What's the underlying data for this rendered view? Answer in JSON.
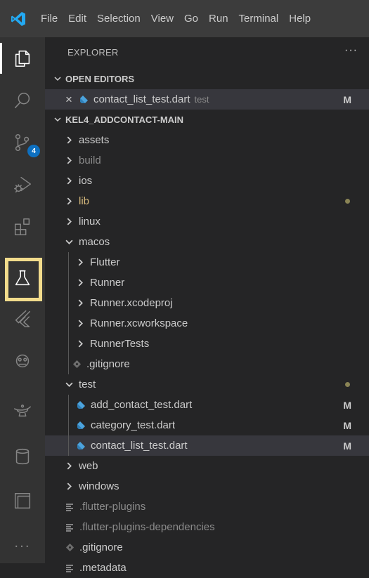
{
  "menubar": {
    "items": [
      "File",
      "Edit",
      "Selection",
      "View",
      "Go",
      "Run",
      "Terminal",
      "Help"
    ]
  },
  "activitybar": {
    "items": [
      {
        "name": "explorer-icon",
        "active": true
      },
      {
        "name": "search-icon"
      },
      {
        "name": "source-control-icon",
        "badge": "4"
      },
      {
        "name": "run-debug-icon"
      },
      {
        "name": "extensions-icon"
      },
      {
        "name": "testing-icon",
        "highlight": true
      },
      {
        "name": "flutter-icon"
      },
      {
        "name": "copilot-icon"
      },
      {
        "name": "genie-lamp-icon"
      },
      {
        "name": "database-icon"
      },
      {
        "name": "panel-icon"
      },
      {
        "name": "more-icon"
      }
    ],
    "more_label": "..."
  },
  "explorer": {
    "title": "EXPLORER",
    "more": "···",
    "open_editors": {
      "title": "OPEN EDITORS",
      "items": [
        {
          "name": "contact_list_test.dart",
          "desc": "test",
          "status": "M"
        }
      ]
    },
    "folder": {
      "title": "KEL4_ADDCONTACT-MAIN",
      "rows": [
        {
          "label": "assets",
          "type": "folder",
          "expanded": false,
          "depth": 0
        },
        {
          "label": "build",
          "type": "folder",
          "expanded": false,
          "depth": 0,
          "dim": true
        },
        {
          "label": "ios",
          "type": "folder",
          "expanded": false,
          "depth": 0
        },
        {
          "label": "lib",
          "type": "folder",
          "expanded": false,
          "depth": 0,
          "modified": true,
          "dot": true
        },
        {
          "label": "linux",
          "type": "folder",
          "expanded": false,
          "depth": 0
        },
        {
          "label": "macos",
          "type": "folder",
          "expanded": true,
          "depth": 0
        },
        {
          "label": "Flutter",
          "type": "folder",
          "expanded": false,
          "depth": 1
        },
        {
          "label": "Runner",
          "type": "folder",
          "expanded": false,
          "depth": 1
        },
        {
          "label": "Runner.xcodeproj",
          "type": "folder",
          "expanded": false,
          "depth": 1
        },
        {
          "label": "Runner.xcworkspace",
          "type": "folder",
          "expanded": false,
          "depth": 1
        },
        {
          "label": "RunnerTests",
          "type": "folder",
          "expanded": false,
          "depth": 1
        },
        {
          "label": ".gitignore",
          "type": "git",
          "depth": 1
        },
        {
          "label": "test",
          "type": "folder",
          "expanded": true,
          "depth": 0,
          "dot": true
        },
        {
          "label": "add_contact_test.dart",
          "type": "dart",
          "depth": 1,
          "status": "M"
        },
        {
          "label": "category_test.dart",
          "type": "dart",
          "depth": 1,
          "status": "M"
        },
        {
          "label": "contact_list_test.dart",
          "type": "dart",
          "depth": 1,
          "status": "M",
          "selected": true
        },
        {
          "label": "web",
          "type": "folder",
          "expanded": false,
          "depth": 0
        },
        {
          "label": "windows",
          "type": "folder",
          "expanded": false,
          "depth": 0
        },
        {
          "label": ".flutter-plugins",
          "type": "lines",
          "depth": 0,
          "dim": true
        },
        {
          "label": ".flutter-plugins-dependencies",
          "type": "lines",
          "depth": 0,
          "dim": true
        },
        {
          "label": ".gitignore",
          "type": "git",
          "depth": 0
        },
        {
          "label": ".metadata",
          "type": "lines",
          "depth": 0
        }
      ]
    }
  },
  "colors": {
    "activitybar_bg": "#333333",
    "sidebar_bg": "#252526",
    "menubar_bg": "#3c3c3c",
    "dart_icon": "#4ba3dd",
    "highlight_box": "#f2dc8c",
    "lib_folder": "#d7ba7d"
  }
}
